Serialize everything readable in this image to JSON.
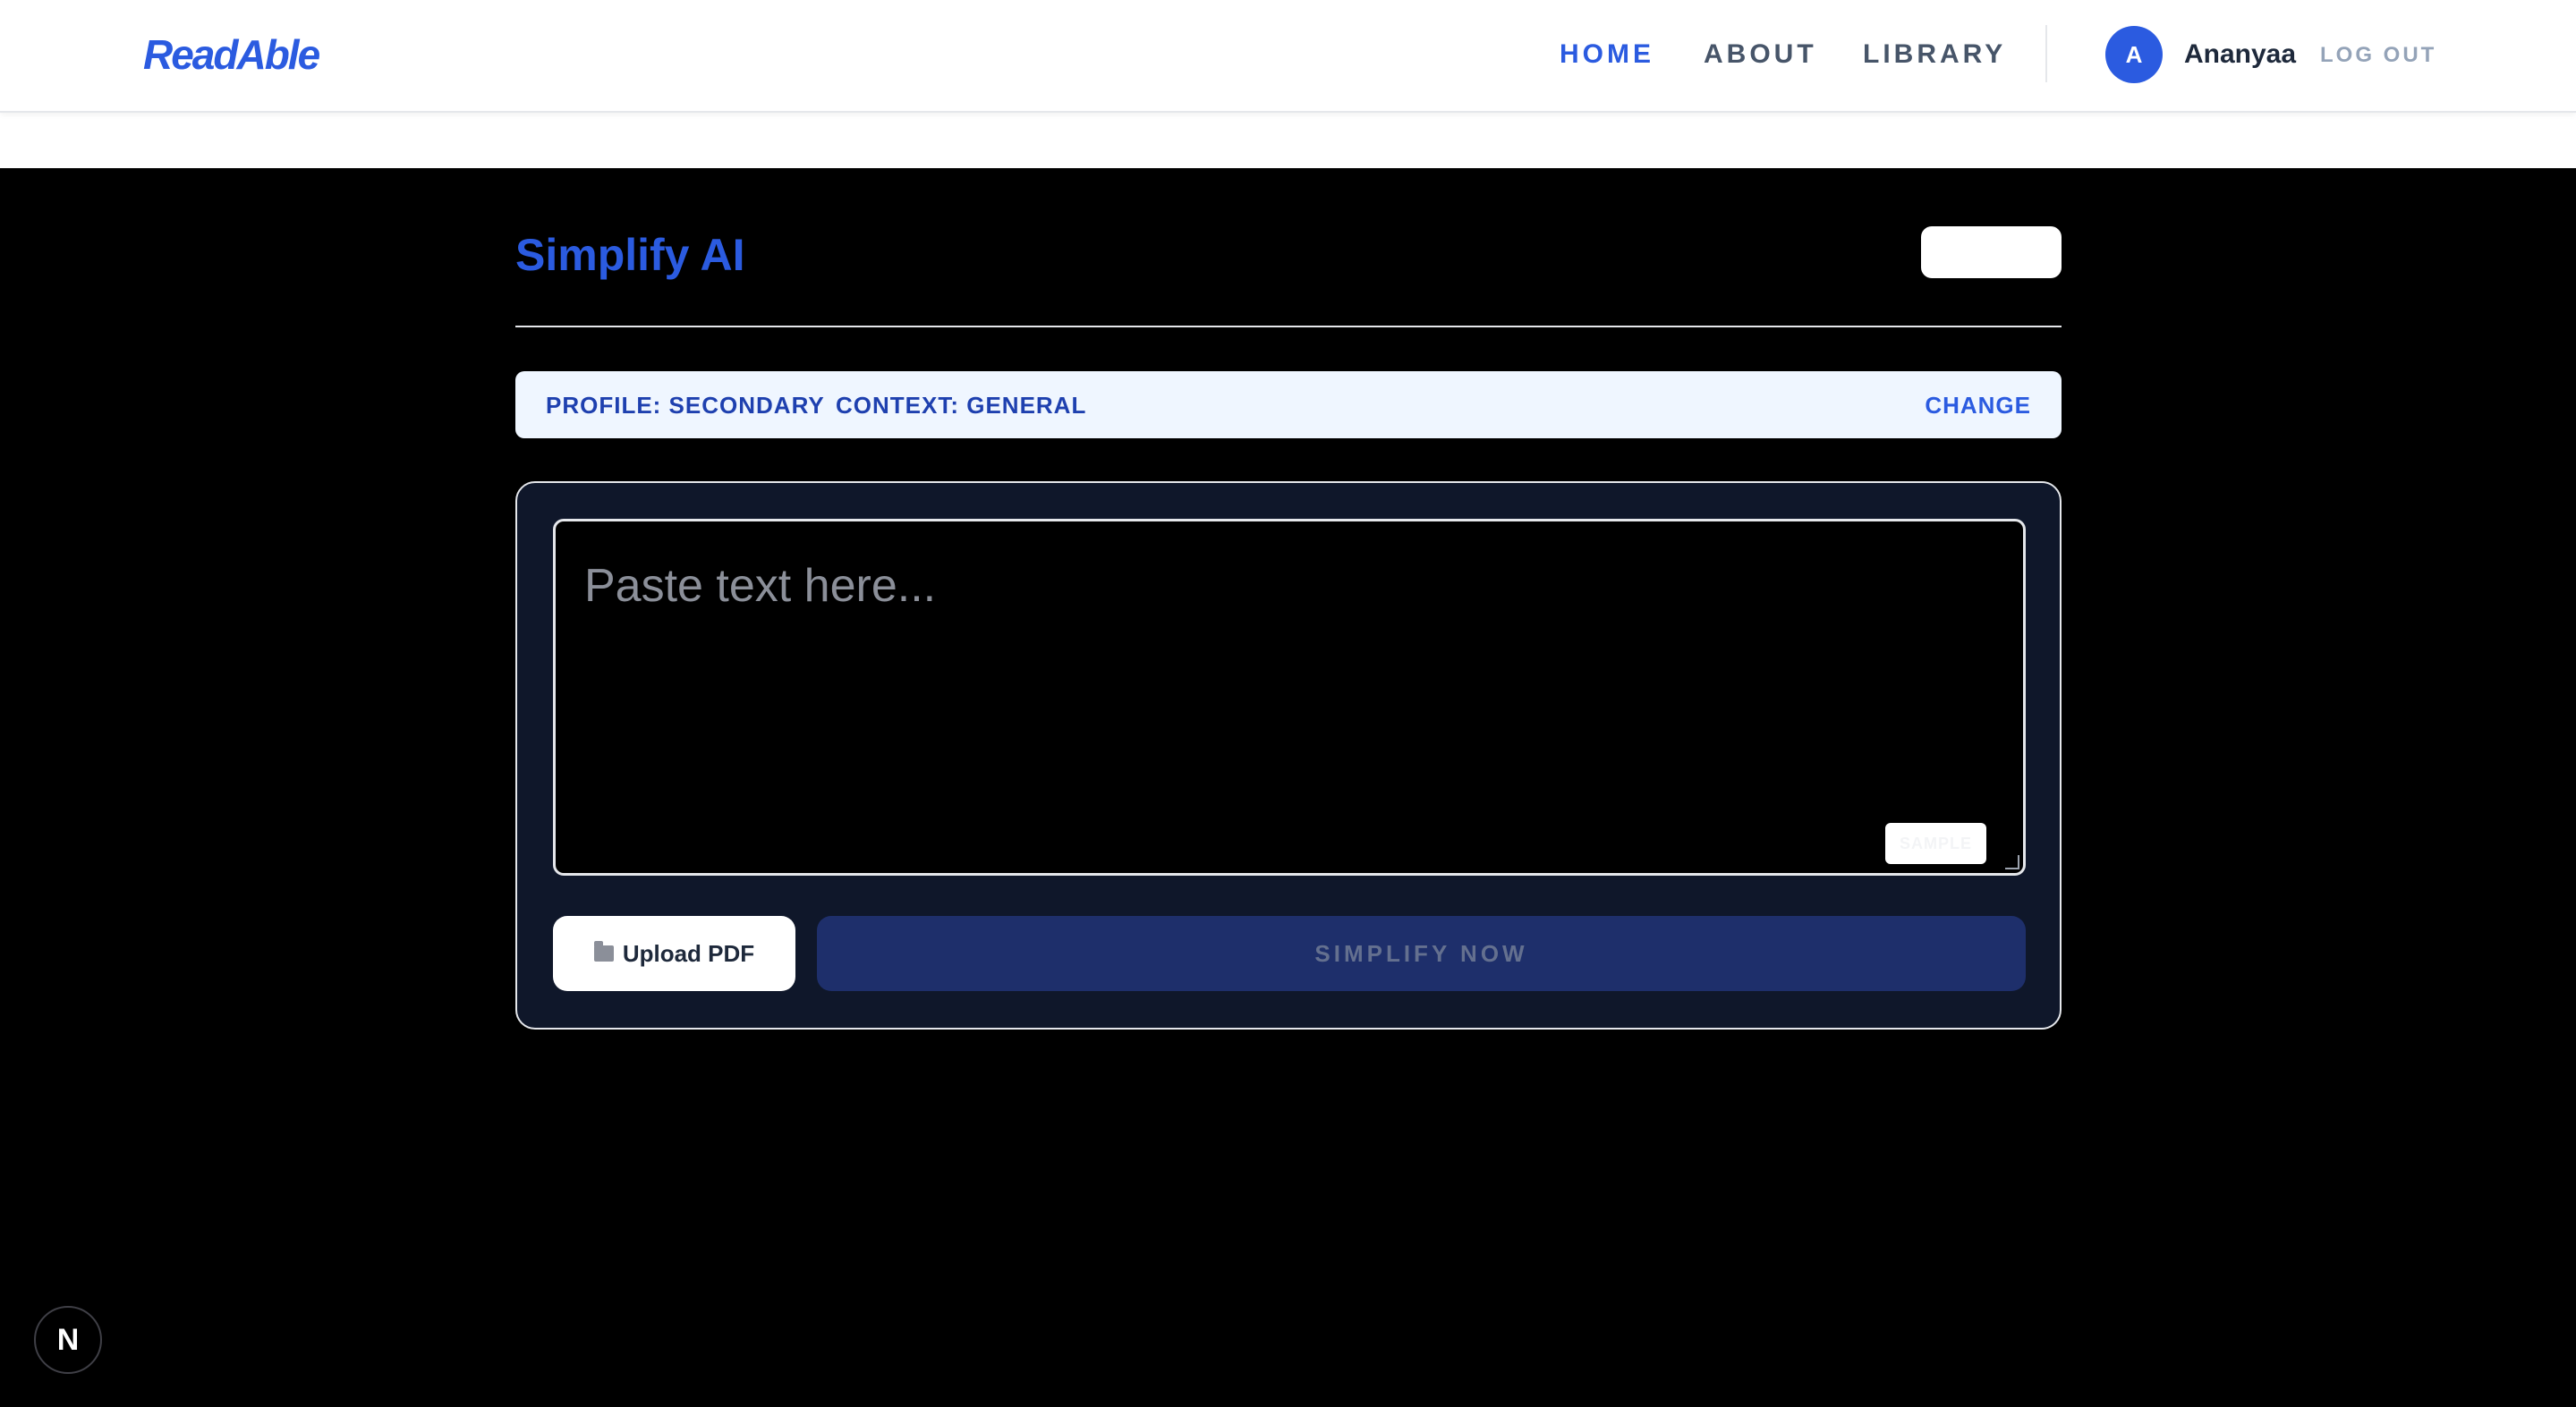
{
  "nav": {
    "logo": "ReadAble",
    "links": [
      "HOME",
      "ABOUT",
      "LIBRARY"
    ],
    "active": "HOME",
    "avatar_initial": "A",
    "username": "Ananyaa",
    "logout": "LOG OUT"
  },
  "main": {
    "title": "Simplify AI",
    "profile_label": "PROFILE: SECONDARY",
    "context_label": "CONTEXT: GENERAL",
    "change_label": "CHANGE",
    "textarea_placeholder": "Paste text here...",
    "sample_label": "SAMPLE",
    "upload_label": "Upload PDF",
    "simplify_label": "SIMPLIFY NOW"
  },
  "badge": {
    "label": "N"
  },
  "colors": {
    "accent": "#2b5be0",
    "background_dark": "#000000",
    "card": "#0f172a",
    "profile_bar": "#eff6ff"
  }
}
